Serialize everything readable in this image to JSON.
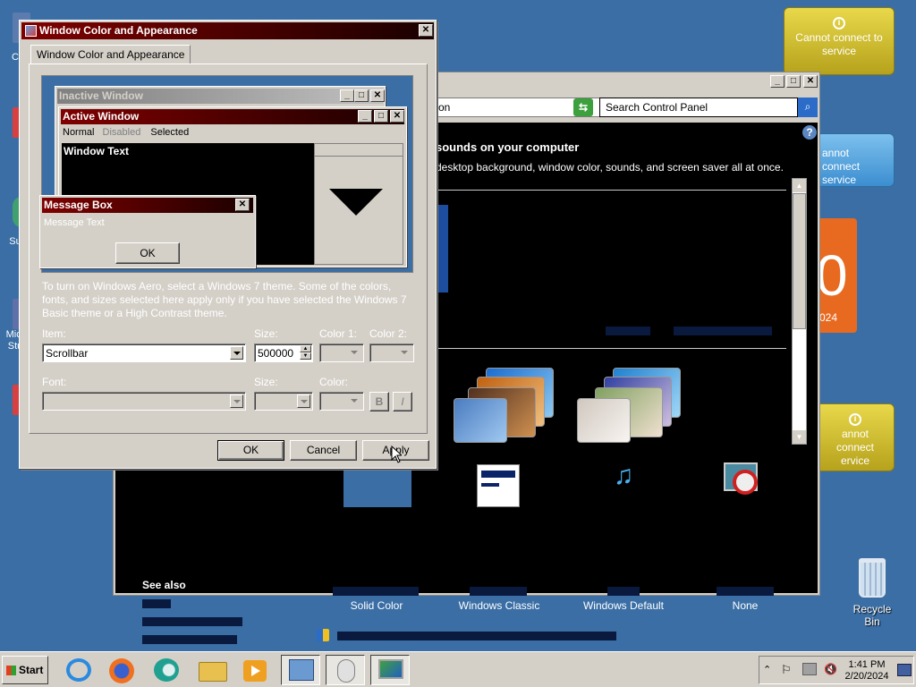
{
  "desktop": {
    "left_fragments": [
      {
        "label": "C"
      },
      {
        "label": "Su"
      },
      {
        "label": "Micr"
      },
      {
        "label": "Stu"
      }
    ],
    "recycle_bin_label": "Recycle Bin"
  },
  "gadgets": {
    "weather_1": "Cannot connect to service",
    "weather_2": "annot connect service",
    "weather_3": "annot connect ervice",
    "calendar_digit": "0",
    "calendar_year": "024"
  },
  "control_panel": {
    "address_fragment": "on",
    "search_placeholder": "Search Control Panel",
    "heading_fragment": "sounds on your computer",
    "subtitle_fragment": "desktop background, window color, sounds, and screen saver all at once.",
    "see_also_title": "See also",
    "themes": [
      {
        "name": "Solid Color"
      },
      {
        "name": "Windows Classic"
      },
      {
        "name": "Windows Default"
      },
      {
        "name": "None"
      }
    ]
  },
  "dialog": {
    "title": "Window Color and Appearance",
    "tab_label": "Window Color and Appearance",
    "preview": {
      "inactive_title": "Inactive Window",
      "active_title": "Active Window",
      "menu_normal": "Normal",
      "menu_disabled": "Disabled",
      "menu_selected": "Selected",
      "window_text": "Window Text",
      "msgbox_title": "Message Box",
      "msgbox_text": "Message Text",
      "msgbox_ok": "OK"
    },
    "aero_note": "To turn on Windows Aero, select a Windows 7 theme. Some of the colors, fonts, and sizes selected here apply only if you have selected the Windows 7 Basic theme or a High Contrast theme.",
    "item_label": "Item:",
    "item_value": "Scrollbar",
    "size_label": "Size:",
    "size_value": "500000",
    "color1_label": "Color 1:",
    "color2_label": "Color 2:",
    "font_label": "Font:",
    "font_size_label": "Size:",
    "font_color_label": "Color:",
    "bold_label": "B",
    "italic_label": "I",
    "ok_label": "OK",
    "cancel_label": "Cancel",
    "apply_label": "Apply"
  },
  "taskbar": {
    "start_label": "Start",
    "time": "1:41 PM",
    "date": "2/20/2024"
  },
  "colors": {
    "desktop": "#3a6ea5",
    "title_active": "#800000",
    "face": "#d4d0c8"
  }
}
